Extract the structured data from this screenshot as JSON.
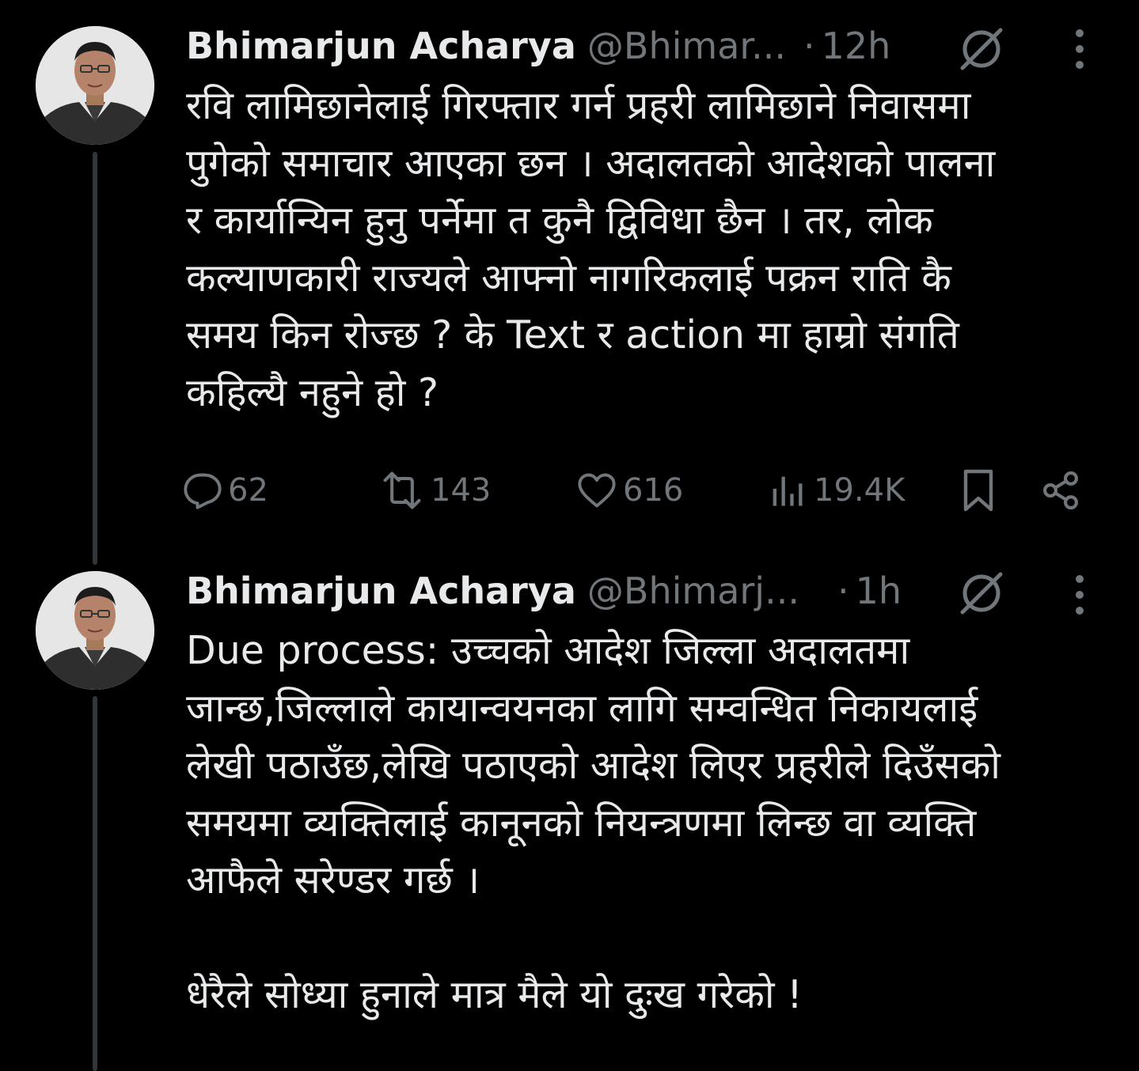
{
  "tweets": [
    {
      "author_name": "Bhimarjun Acharya",
      "handle": "@Bhimar...",
      "dot": "·",
      "time": "12h",
      "text": "रवि लामिछानेलाई गिरफ्तार गर्न प्रहरी लामिछाने निवासमा\nपुगेको समाचार आएका छन । अदालतको आदेशको पालना\nर कार्यान्यिन हुनु पर्नेमा त कुनै द्विविधा छैन । तर, लोक\nकल्याणकारी राज्यले आफ्नो नागरिकलाई पक्रन राति कै\nसमय किन रोज्छ ? के Text र action मा हाम्रो संगति\nकहिल्यै नहुने हो ?",
      "actions": {
        "replies": "62",
        "reposts": "143",
        "likes": "616",
        "views": "19.4K"
      }
    },
    {
      "author_name": "Bhimarjun Acharya",
      "handle": "@Bhimarj...",
      "dot": "·",
      "time": "1h",
      "text": "Due process: उच्चको आदेश जिल्ला अदालतमा\nजान्छ,जिल्लाले कायान्वयनका लागि सम्वन्धित निकायलाई\nलेखी पठाउँछ,लेखि पठाएको आदेश लिएर प्रहरीले दिउँसको\nसमयमा व्यक्तिलाई कानूनको नियन्त्रणमा लिन्छ वा व्यक्ति\nआफैले सरेण्डर गर्छ ।\n\nधेरैले सोध्या हुनाले मात्र मैले यो दुःख गरेको !"
    }
  ],
  "icons": {
    "reply": "reply-icon",
    "repost": "repost-icon",
    "like": "heart-icon",
    "views": "views-icon",
    "bookmark": "bookmark-icon",
    "share": "share-icon",
    "grok": "grok-icon",
    "more": "more-icon"
  },
  "colors": {
    "background": "#000000",
    "primary_text": "#e7e9ea",
    "secondary_text": "#71767b",
    "thread_line": "#333639"
  }
}
